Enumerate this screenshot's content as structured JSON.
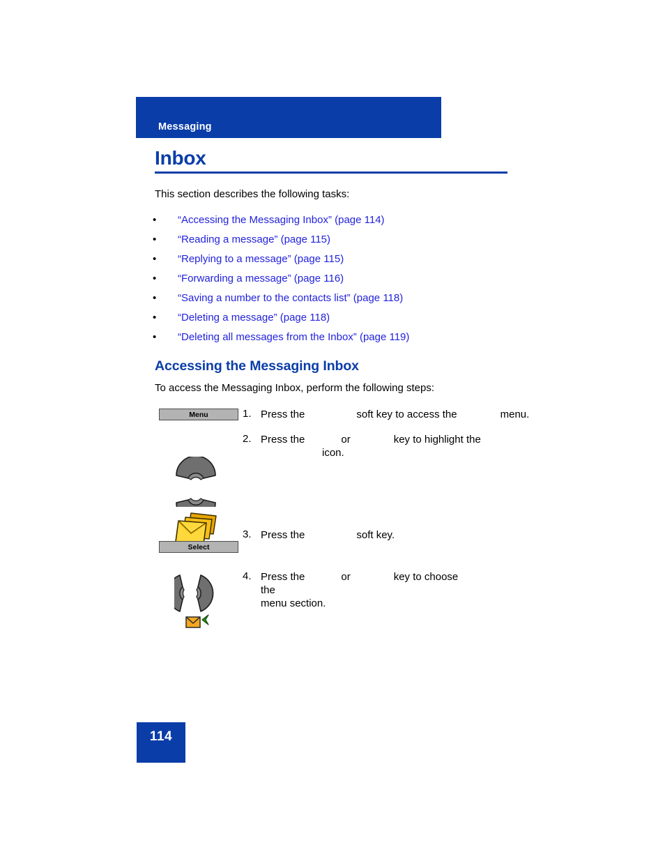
{
  "page": {
    "running_header": "Messaging",
    "chapter_title": "Inbox",
    "page_number": "114",
    "accent_color": "#0A3DA8",
    "link_color": "#2222DD"
  },
  "intro": {
    "text": "This section describes the following tasks:"
  },
  "task_links": {
    "bullet": "•",
    "items": [
      {
        "label": "“Accessing the Messaging Inbox” (page 114)"
      },
      {
        "label": "“Reading a message” (page 115)"
      },
      {
        "label": "“Replying to a message” (page 115)"
      },
      {
        "label": "“Forwarding a message” (page 116)"
      },
      {
        "label": "“Saving a number to the contacts list” (page 118)"
      },
      {
        "label": "“Deleting a message” (page 118)"
      },
      {
        "label": "“Deleting all messages from the Inbox” (page 119)"
      }
    ]
  },
  "section": {
    "heading": "Accessing the Messaging Inbox",
    "intro": "To access the Messaging Inbox, perform the following steps:"
  },
  "steps": [
    {
      "number": "1.",
      "softkey_label": "Menu",
      "text_a": "Press the",
      "text_b": "soft key to access the",
      "text_c": "menu."
    },
    {
      "number": "2.",
      "text_a": "Press the",
      "text_b": "or",
      "text_c": "key to highlight the",
      "text_d": "icon."
    },
    {
      "number": "3.",
      "softkey_label": "Select",
      "text_a": "Press the",
      "text_b": "soft key."
    },
    {
      "number": "4.",
      "text_a": "Press the",
      "text_b": "or",
      "text_c": "key to choose the",
      "text_d": "menu section."
    }
  ]
}
